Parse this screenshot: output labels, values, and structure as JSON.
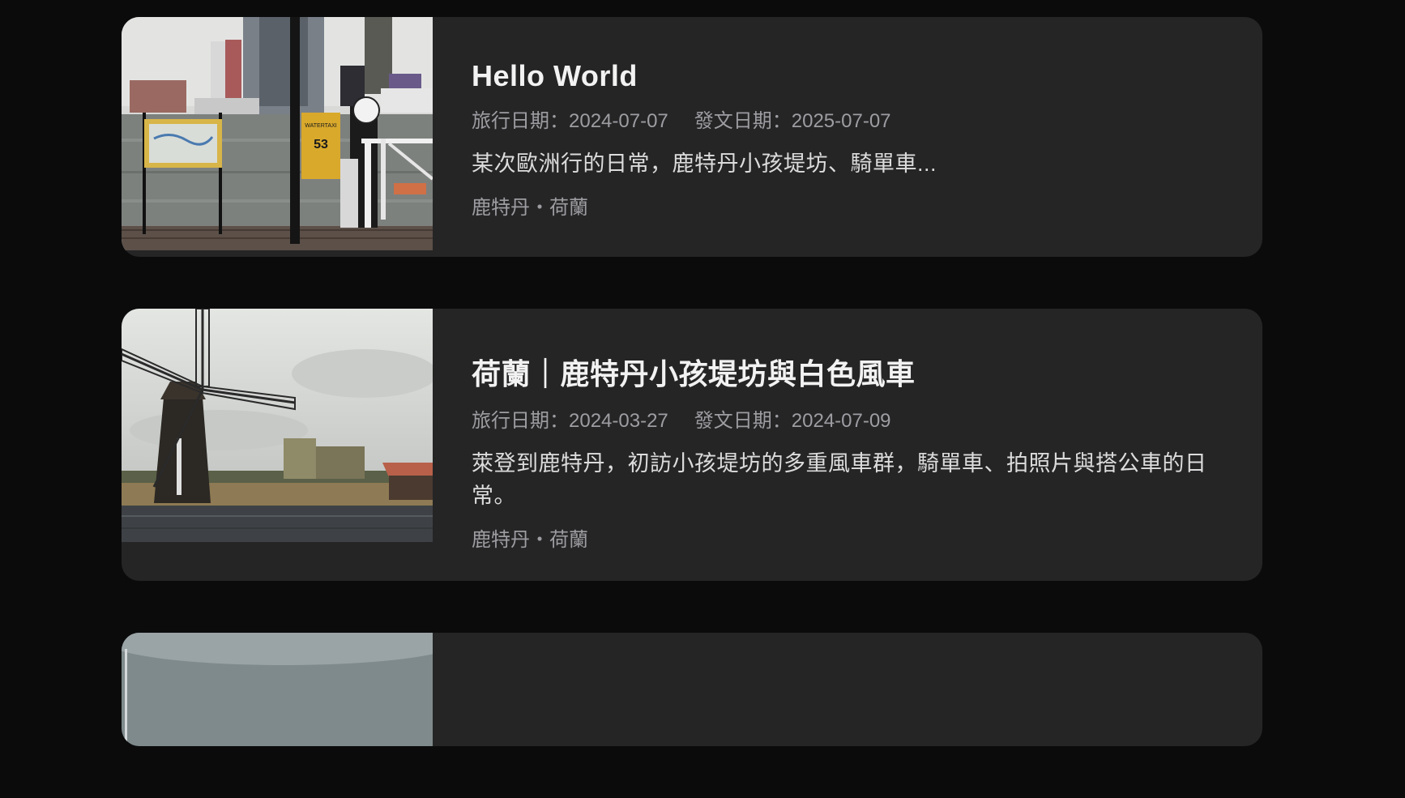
{
  "posts": [
    {
      "title": "Hello World",
      "travel_date": "旅行日期：2024-07-07",
      "post_date": "發文日期：2025-07-07",
      "excerpt": "某次歐洲行的日常，鹿特丹小孩堤坊、騎單車...",
      "location": "鹿特丹・荷蘭",
      "image_sign_text": "WATERTAXI",
      "image_sign_number": "53"
    },
    {
      "title": "荷蘭｜鹿特丹小孩堤坊與白色風車",
      "travel_date": "旅行日期：2024-03-27",
      "post_date": "發文日期：2024-07-09",
      "excerpt": "萊登到鹿特丹，初訪小孩堤坊的多重風車群，騎單車、拍照片與搭公車的日常。",
      "location": "鹿特丹・荷蘭"
    },
    {
      "title": "",
      "travel_date": "",
      "post_date": "",
      "excerpt": "",
      "location": ""
    }
  ]
}
